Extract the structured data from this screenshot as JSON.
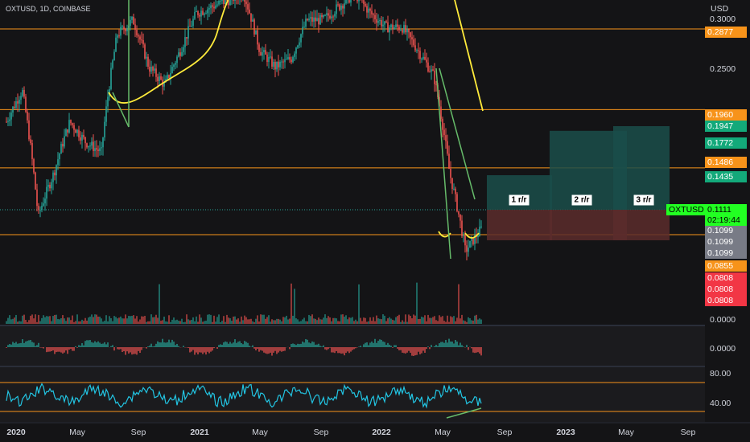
{
  "header": {
    "symbol_line": "OXTUSD, 1D, COINBASE",
    "currency": "USD"
  },
  "price_axis": {
    "ticks": [
      "0.3000",
      "0.2500"
    ],
    "labels": [
      {
        "value": "0.2877",
        "color": "#f7931a"
      },
      {
        "value": "0.1960",
        "color": "#f7931a"
      },
      {
        "value": "0.1947",
        "color": "#13a97a"
      },
      {
        "value": "0.1772",
        "color": "#13a97a"
      },
      {
        "value": "0.1486",
        "color": "#f7931a"
      },
      {
        "value": "0.1435",
        "color": "#13a97a"
      },
      {
        "value": "0.1099",
        "color": "#787b86"
      },
      {
        "value": "0.1099",
        "color": "#787b86"
      },
      {
        "value": "0.1099",
        "color": "#787b86"
      },
      {
        "value": "0.0855",
        "color": "#f7931a"
      },
      {
        "value": "0.0808",
        "color": "#f23645"
      },
      {
        "value": "0.0808",
        "color": "#f23645"
      },
      {
        "value": "0.0808",
        "color": "#f23645"
      }
    ],
    "last_price": {
      "symbol": "OXTUSD",
      "value": "0.1111",
      "countdown": "02:19:44",
      "color": "#22ff22"
    },
    "volume_zero": "0.0000"
  },
  "oscillator": {
    "zero_label": "0.0000"
  },
  "rsi": {
    "upper": "80.00",
    "lower": "40.00"
  },
  "time_axis": [
    "2020",
    "May",
    "Sep",
    "2021",
    "May",
    "Sep",
    "2022",
    "May",
    "Sep",
    "2023",
    "May",
    "Sep"
  ],
  "targets": [
    "1 r/r",
    "2 r/r",
    "3 r/r"
  ],
  "colors": {
    "up": "#26a69a",
    "down": "#ef5350",
    "level": "#f7931a",
    "ma": "#ffeb3b",
    "trend": "#66bb6a",
    "rsi": "#22c5e3",
    "target": "#1a4e4a",
    "stop": "#5a2b2b"
  },
  "chart_data": {
    "type": "candlestick",
    "symbol": "OXTUSD",
    "interval": "1D",
    "exchange": "COINBASE",
    "x_range": [
      "2020-01",
      "2023-09"
    ],
    "ylim": [
      0.08,
      0.31
    ],
    "horizontal_levels": [
      0.2877,
      0.196,
      0.1486,
      0.0855
    ],
    "last_price": 0.1111,
    "series": [
      {
        "date": "2020-01",
        "close": 0.185
      },
      {
        "date": "2020-02",
        "close": 0.215
      },
      {
        "date": "2020-03",
        "close": 0.118
      },
      {
        "date": "2020-04",
        "close": 0.145
      },
      {
        "date": "2020-05",
        "close": 0.185
      },
      {
        "date": "2020-06",
        "close": 0.168
      },
      {
        "date": "2020-07",
        "close": 0.16
      },
      {
        "date": "2020-08",
        "close": 0.28
      },
      {
        "date": "2020-09",
        "close": 0.3
      },
      {
        "date": "2020-10",
        "close": 0.24
      },
      {
        "date": "2020-11",
        "close": 0.22
      },
      {
        "date": "2020-12",
        "close": 0.26
      },
      {
        "date": "2021-01",
        "close": 0.31
      },
      {
        "date": "2021-02",
        "close": 0.32
      },
      {
        "date": "2021-03",
        "close": 0.33
      },
      {
        "date": "2021-04",
        "close": 0.34
      },
      {
        "date": "2021-05",
        "close": 0.26
      },
      {
        "date": "2021-06",
        "close": 0.24
      },
      {
        "date": "2021-07",
        "close": 0.25
      },
      {
        "date": "2021-08",
        "close": 0.3
      },
      {
        "date": "2021-09",
        "close": 0.3
      },
      {
        "date": "2021-10",
        "close": 0.32
      },
      {
        "date": "2021-11",
        "close": 0.34
      },
      {
        "date": "2021-12",
        "close": 0.31
      },
      {
        "date": "2022-01",
        "close": 0.29
      },
      {
        "date": "2022-02",
        "close": 0.29
      },
      {
        "date": "2022-03",
        "close": 0.26
      },
      {
        "date": "2022-04",
        "close": 0.23
      },
      {
        "date": "2022-05",
        "close": 0.145
      },
      {
        "date": "2022-06",
        "close": 0.1
      },
      {
        "date": "2022-07",
        "close": 0.1111
      }
    ],
    "targets": [
      {
        "label": "1 r/r",
        "entry": 0.1111,
        "target": 0.1435,
        "stop": 0.0855
      },
      {
        "label": "2 r/r",
        "entry": 0.1111,
        "target": 0.1772,
        "stop": 0.0855
      },
      {
        "label": "3 r/r",
        "entry": 0.1111,
        "target": 0.1947,
        "stop": 0.0855
      }
    ],
    "rsi_levels": [
      80,
      40
    ]
  }
}
